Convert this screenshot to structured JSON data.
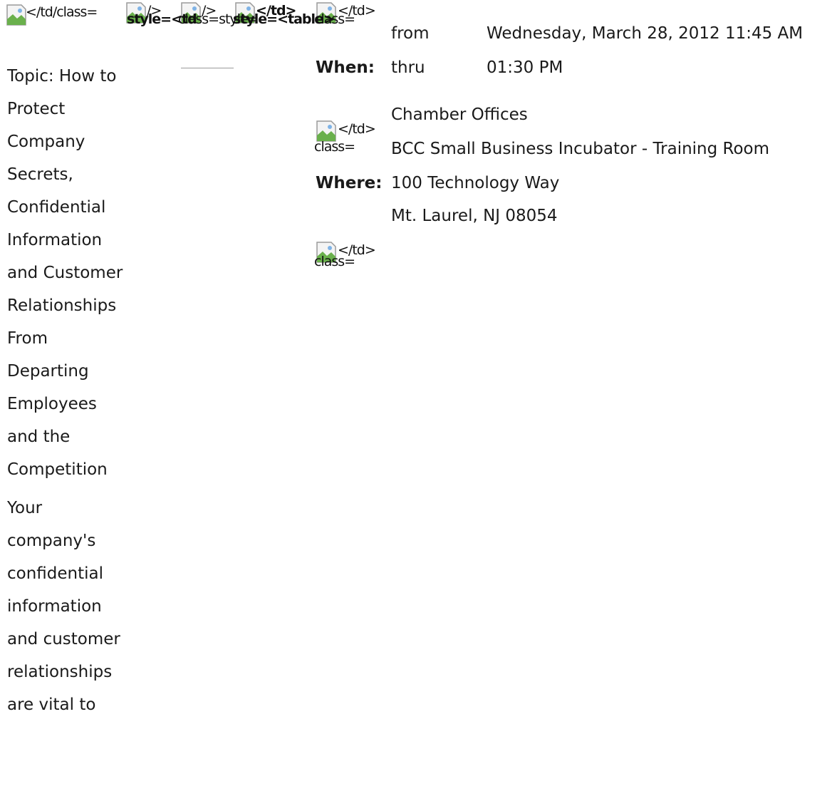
{
  "fragments": {
    "f1": "</td/class=",
    "f2": "/>",
    "f3": "style=<td",
    "f4": "/>",
    "f5": "class=style=",
    "f6": "</td>",
    "f7": "style=<table>",
    "f8": "</td>",
    "f9": "class=",
    "f10": "</td>",
    "f11": "class=",
    "f12": "</td>",
    "f13": "class="
  },
  "left_column": {
    "topic": "Topic: How to Protect Company Secrets, Confidential Information and Customer Relationships From Departing Employees and the Competition",
    "body": "Your company's confidential information and customer relationships are vital to"
  },
  "when": {
    "label": "When:",
    "from_label": "from",
    "from_value": "Wednesday, March 28, 2012 11:45 AM",
    "thru_label": "thru",
    "thru_value": "01:30 PM"
  },
  "where": {
    "label": "Where:",
    "line1": "Chamber Offices",
    "line2": "BCC Small Business Incubator - Training Room",
    "line3": "100 Technology Way",
    "line4": "Mt. Laurel, NJ 08054"
  },
  "icons": {
    "broken_image": "broken-image-icon"
  }
}
